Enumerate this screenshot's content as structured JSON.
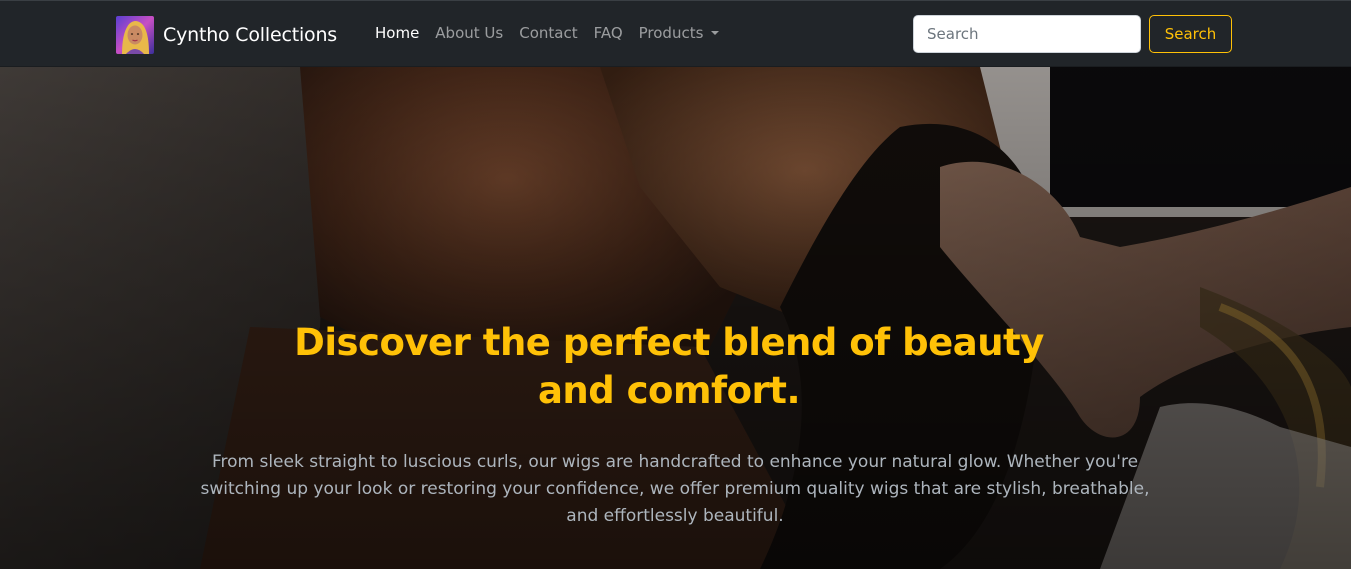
{
  "brand": {
    "name": "Cyntho Collections",
    "logo_icon": "profile-photo-logo"
  },
  "nav": {
    "items": [
      {
        "label": "Home",
        "active": true
      },
      {
        "label": "About Us",
        "active": false
      },
      {
        "label": "Contact",
        "active": false
      },
      {
        "label": "FAQ",
        "active": false
      },
      {
        "label": "Products",
        "active": false,
        "dropdown": true
      }
    ]
  },
  "search": {
    "placeholder": "Search",
    "button_label": "Search"
  },
  "hero": {
    "title": "Discover the perfect blend of beauty and comfort.",
    "text": "From sleek straight to luscious curls, our wigs are handcrafted to enhance your natural glow. Whether you're switching up your look or restoring your confidence, we offer premium quality wigs that are stylish, breathable, and effortlessly beautiful."
  },
  "colors": {
    "navbar_bg": "#212529",
    "accent": "#ffc107",
    "hero_text": "#adb5bd"
  }
}
